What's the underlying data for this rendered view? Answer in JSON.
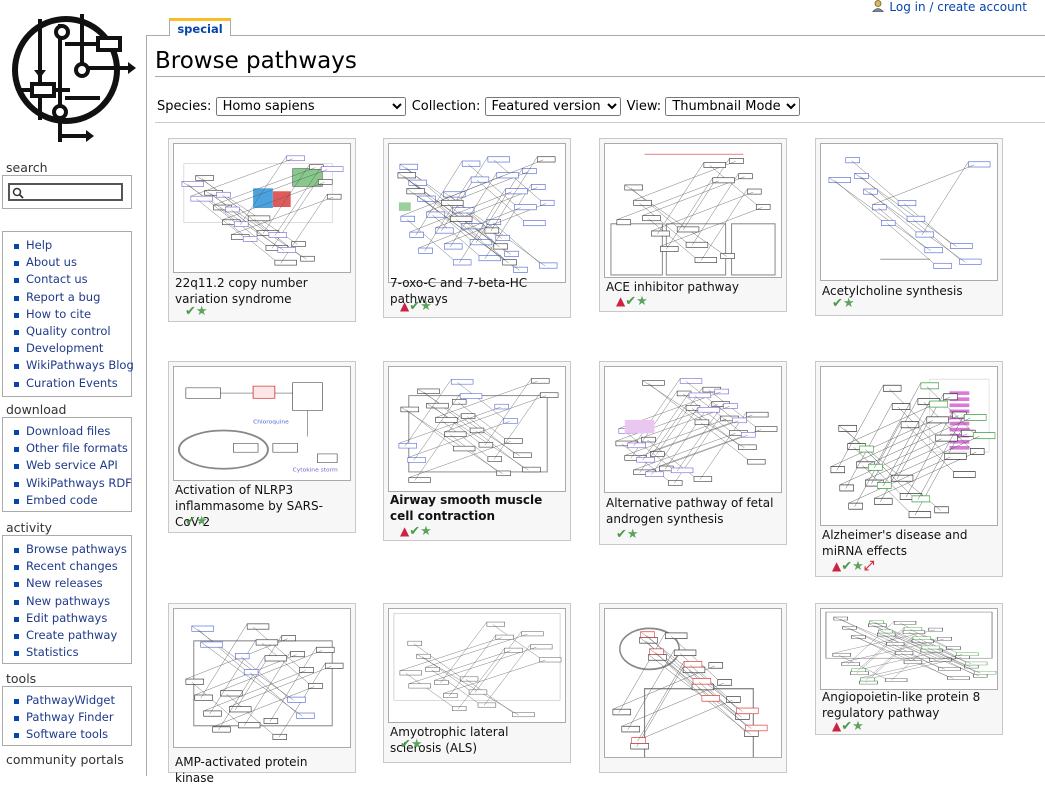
{
  "header": {
    "tab_label": "special",
    "login_text": "Log in / create account",
    "page_title": "Browse pathways"
  },
  "search": {
    "heading": "search",
    "placeholder": ""
  },
  "sidebar": {
    "nav": [
      "Help",
      "About us",
      "Contact us",
      "Report a bug",
      "How to cite",
      "Quality control",
      "Development",
      "WikiPathways Blog",
      "Curation Events"
    ],
    "download_heading": "download",
    "download": [
      "Download files",
      "Other file formats",
      "Web service API",
      "WikiPathways RDF",
      "Embed code"
    ],
    "activity_heading": "activity",
    "activity": [
      "Browse pathways",
      "Recent changes",
      "New releases",
      "New pathways",
      "Edit pathways",
      "Create pathway",
      "Statistics"
    ],
    "tools_heading": "tools",
    "tools": [
      "PathwayWidget",
      "Pathway Finder",
      "Software tools"
    ],
    "portals_heading": "community portals"
  },
  "filters": {
    "species_label": "Species:",
    "species_value": "Homo sapiens",
    "collection_label": "Collection:",
    "collection_value": "Featured version",
    "view_label": "View:",
    "view_value": "Thumbnail Mode"
  },
  "cards": [
    {
      "title": "22q11.2 copy number variation syndrome",
      "bold": false,
      "badges": [
        "check",
        "star"
      ]
    },
    {
      "title": "7-oxo-C and 7-beta-HC pathways",
      "bold": false,
      "badges": [
        "warn",
        "check",
        "star"
      ]
    },
    {
      "title": "ACE inhibitor pathway",
      "bold": false,
      "badges": [
        "warn",
        "check",
        "star"
      ]
    },
    {
      "title": "Acetylcholine synthesis",
      "bold": false,
      "badges": [
        "check",
        "star"
      ]
    },
    {
      "title": "Activation of NLRP3 inflammasome by SARS-CoV-2",
      "bold": false,
      "badges": [
        "check",
        "star"
      ]
    },
    {
      "title": "Airway smooth muscle cell contraction",
      "bold": true,
      "badges": [
        "warn",
        "check",
        "star"
      ]
    },
    {
      "title": "Alternative pathway of fetal androgen synthesis",
      "bold": false,
      "badges": [
        "check",
        "star"
      ]
    },
    {
      "title": "Alzheimer's disease and miRNA effects",
      "bold": false,
      "badges": [
        "warn",
        "check",
        "star",
        "arrow"
      ]
    },
    {
      "title": "AMP-activated protein kinase",
      "bold": false,
      "badges": []
    },
    {
      "title": "Amyotrophic lateral sclerosis (ALS)",
      "bold": false,
      "badges": [
        "check",
        "star"
      ]
    },
    {
      "title": "",
      "bold": false,
      "badges": []
    },
    {
      "title": "Angiopoietin-like protein 8 regulatory pathway",
      "bold": false,
      "badges": [
        "warn",
        "check",
        "star"
      ]
    }
  ],
  "thumb_texts": {
    "nlrp3": [
      "NFKB1",
      "RELA",
      "TRAF3",
      "ORF3a",
      "NLRP3",
      "ASC",
      "pro-CASP1",
      "CASP1",
      "IL18",
      "pro-IL18",
      "pro-IL1B",
      "IL1B",
      "Chloroquine",
      "Cytokine storm",
      "Nucleus"
    ]
  },
  "colors": {
    "accent": "#fabd23",
    "link": "#0645ad",
    "check": "#4a9a4a",
    "warn": "#c24"
  }
}
